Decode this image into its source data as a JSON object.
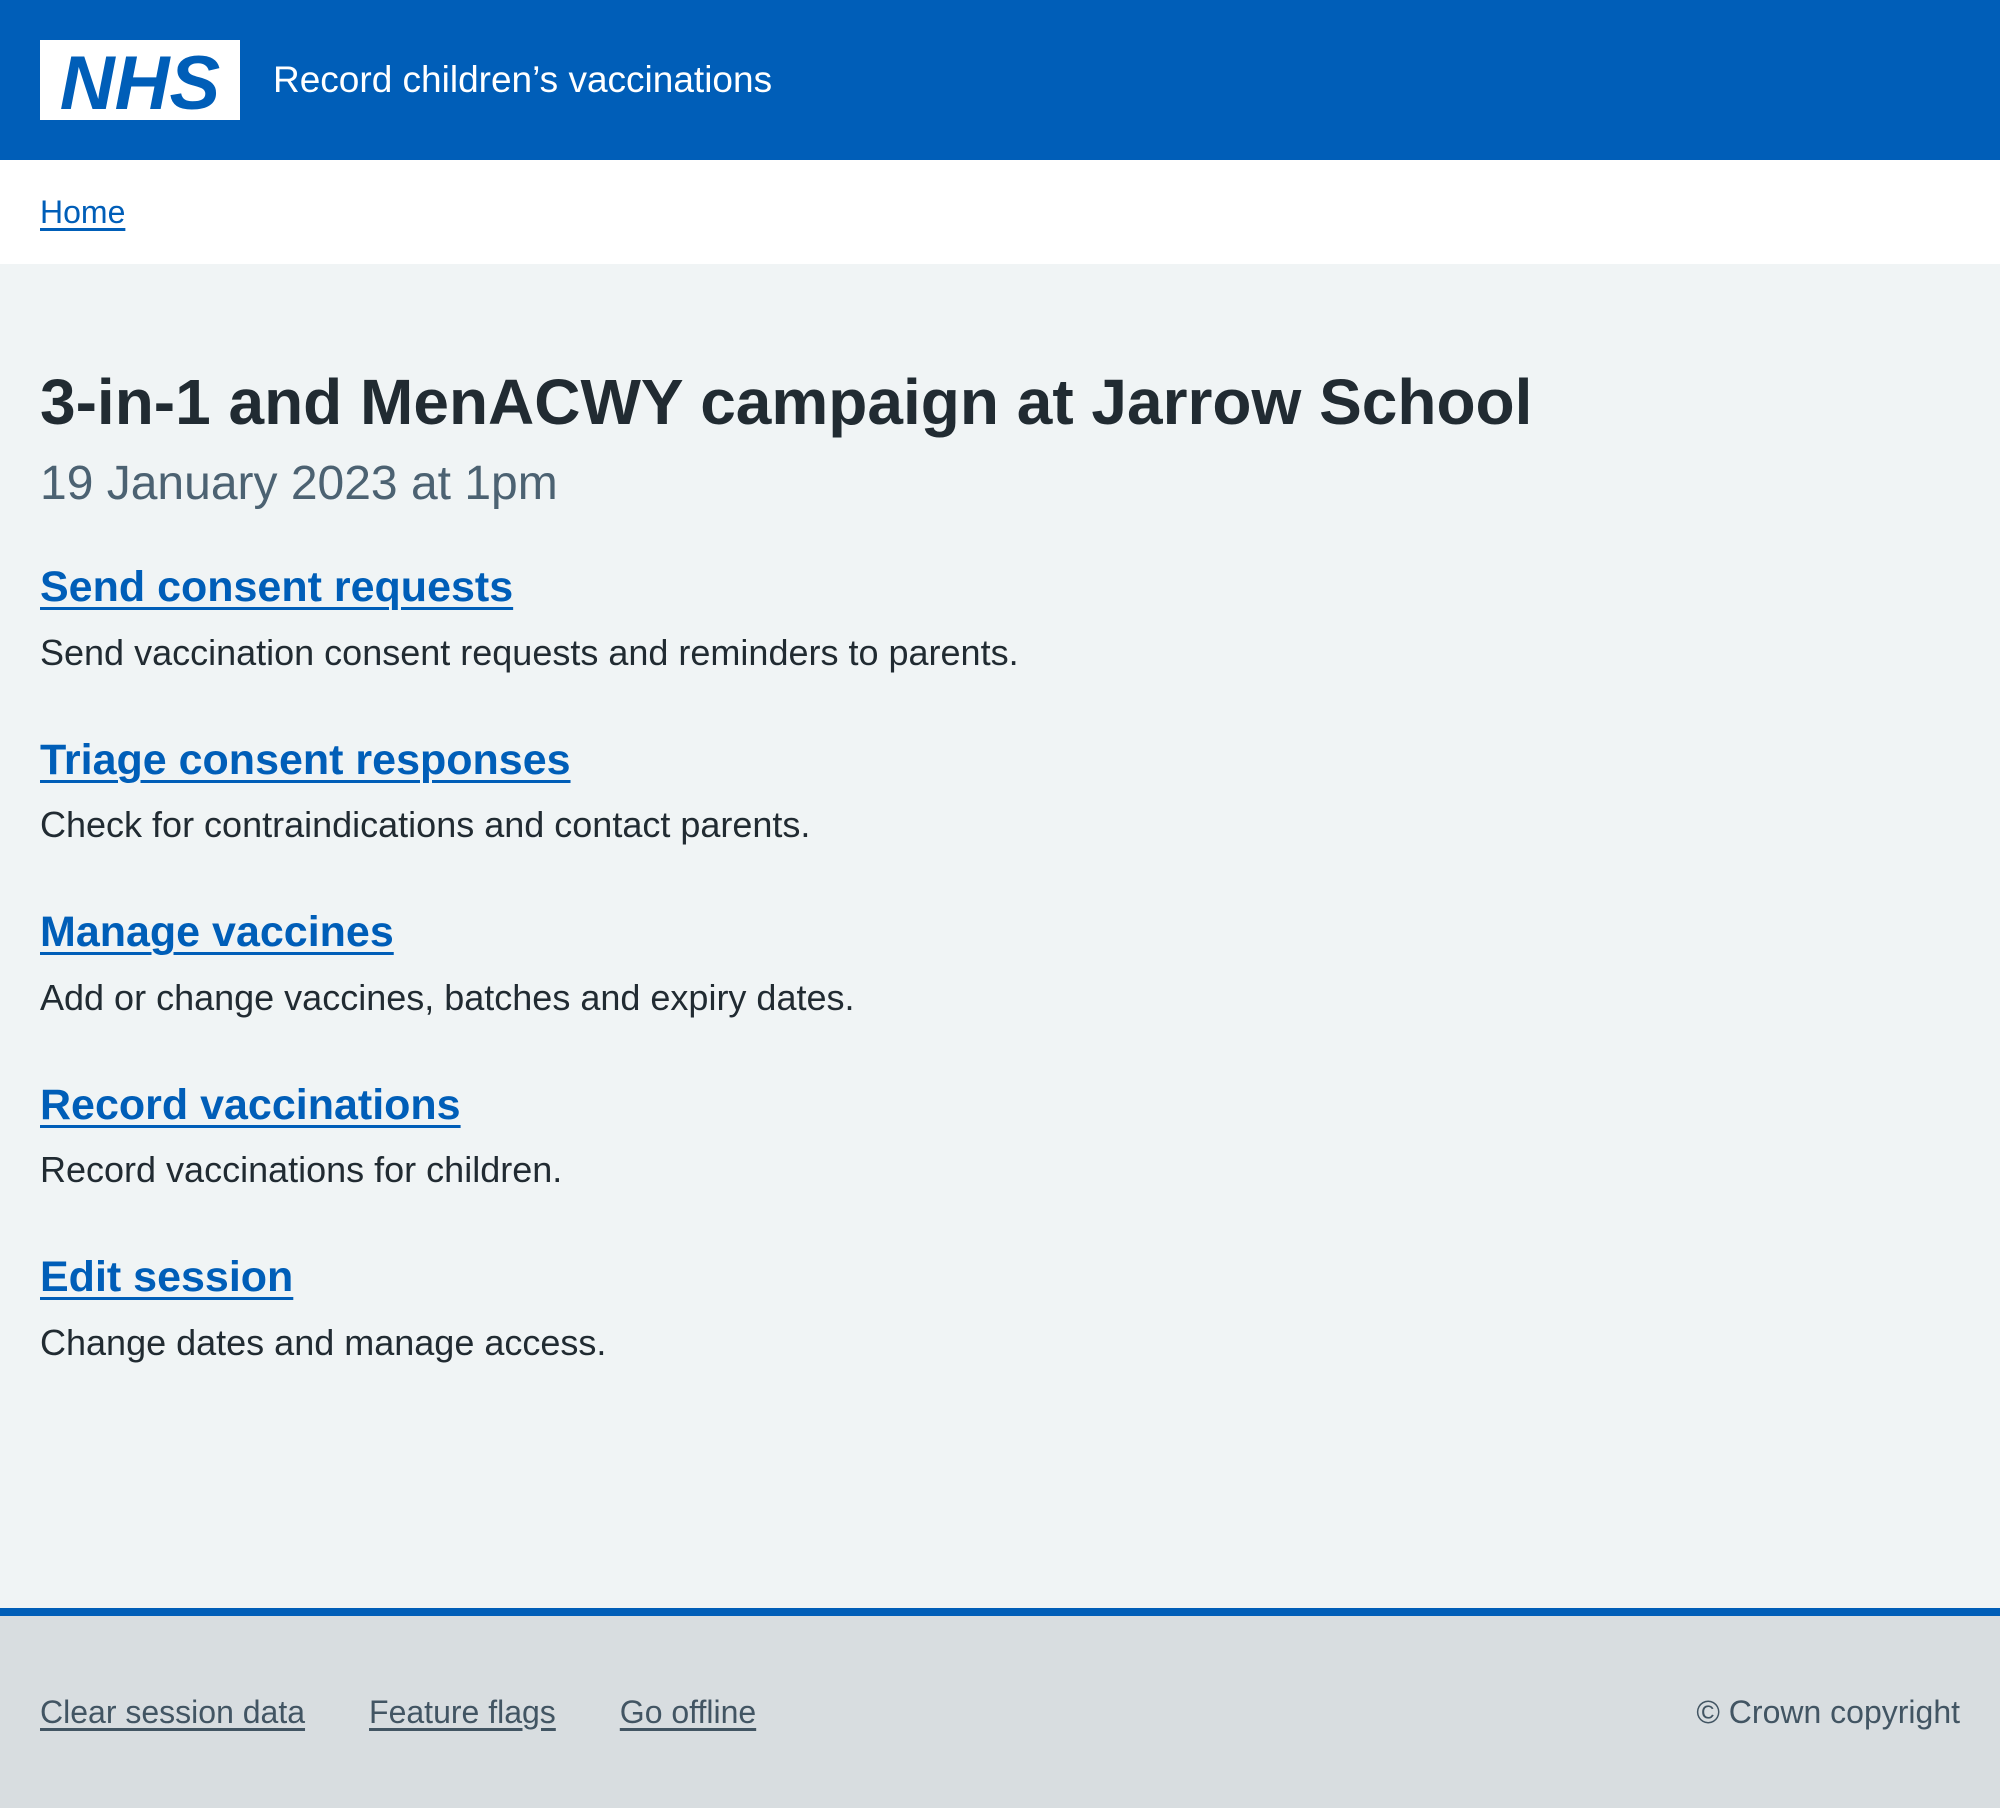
{
  "header": {
    "logo_text": "NHS",
    "service_name": "Record children’s vaccinations"
  },
  "breadcrumb": {
    "home": "Home"
  },
  "page": {
    "title": "3-in-1 and MenACWY campaign at Jarrow School",
    "caption": "19 January 2023 at 1pm"
  },
  "actions": [
    {
      "label": "Send consent requests",
      "description": "Send vaccination consent requests and reminders to parents."
    },
    {
      "label": "Triage consent responses",
      "description": "Check for contraindications and contact parents."
    },
    {
      "label": "Manage vaccines",
      "description": "Add or change vaccines, batches and expiry dates."
    },
    {
      "label": "Record vaccinations",
      "description": "Record vaccinations for children."
    },
    {
      "label": "Edit session",
      "description": "Change dates and manage access."
    }
  ],
  "footer": {
    "links": [
      "Clear session data",
      "Feature flags",
      "Go offline"
    ],
    "copyright": "© Crown copyright"
  },
  "colors": {
    "nhs_blue": "#005eb8",
    "background": "#f0f4f5",
    "footer_background": "#d8dde0",
    "text": "#212b32",
    "secondary_text": "#4c6272"
  }
}
